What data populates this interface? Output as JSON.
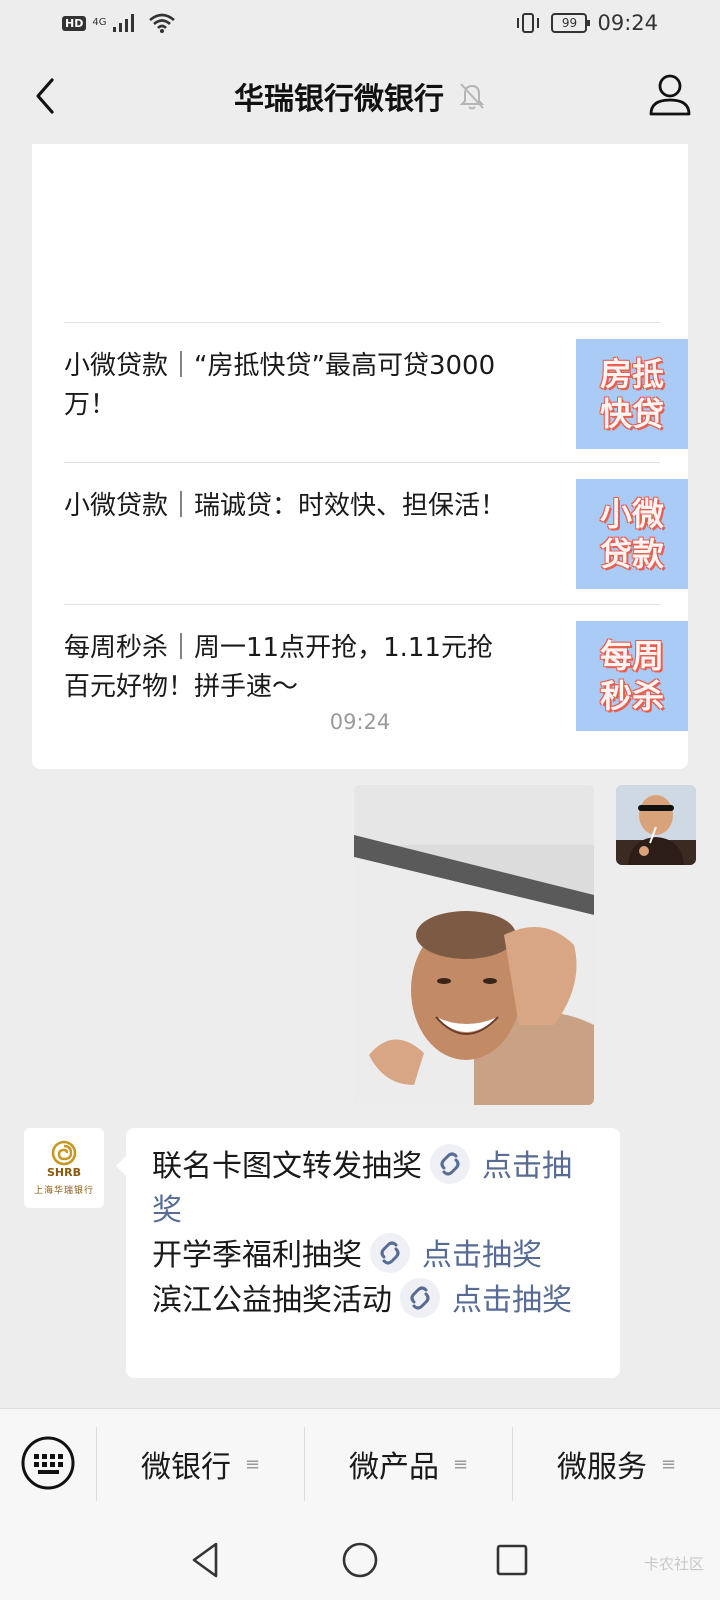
{
  "status_bar": {
    "hd": "HD",
    "network": "4G",
    "battery": "99",
    "time": "09:24"
  },
  "header": {
    "title": "华瑞银行微银行",
    "mute_icon": "bell-slash-icon",
    "profile_icon": "person-icon",
    "back_icon": "chevron-left-icon"
  },
  "articles": [
    {
      "title": "小微贷款｜“房抵快贷”最高可贷3000万！",
      "thumb": "房抵快贷"
    },
    {
      "title": "小微贷款｜瑞诚贷：时效快、担保活！",
      "thumb": "小微贷款"
    },
    {
      "title": "每周秒杀｜周一11点开抢，1.11元抢百元好物！拼手速～",
      "thumb": "每周秒杀"
    }
  ],
  "timestamp": "09:24",
  "bank": {
    "logo_text": "SHRB",
    "logo_sub": "上海华瑞银行"
  },
  "promos": [
    {
      "text": "联名卡图文转发抽奖",
      "link": "点击抽奖"
    },
    {
      "text": "开学季福利抽奖",
      "link": "点击抽奖"
    },
    {
      "text": "滨江公益抽奖活动",
      "link": "点击抽奖"
    }
  ],
  "menu": {
    "items": [
      {
        "label": "微银行"
      },
      {
        "label": "微产品"
      },
      {
        "label": "微服务"
      }
    ],
    "lines_glyph": "≡"
  },
  "watermark": "卡农社区",
  "colors": {
    "background": "#ededed",
    "link": "#576b95",
    "thumb_bg": "#a9cbf5",
    "thumb_text_stroke": "#e7604f"
  }
}
